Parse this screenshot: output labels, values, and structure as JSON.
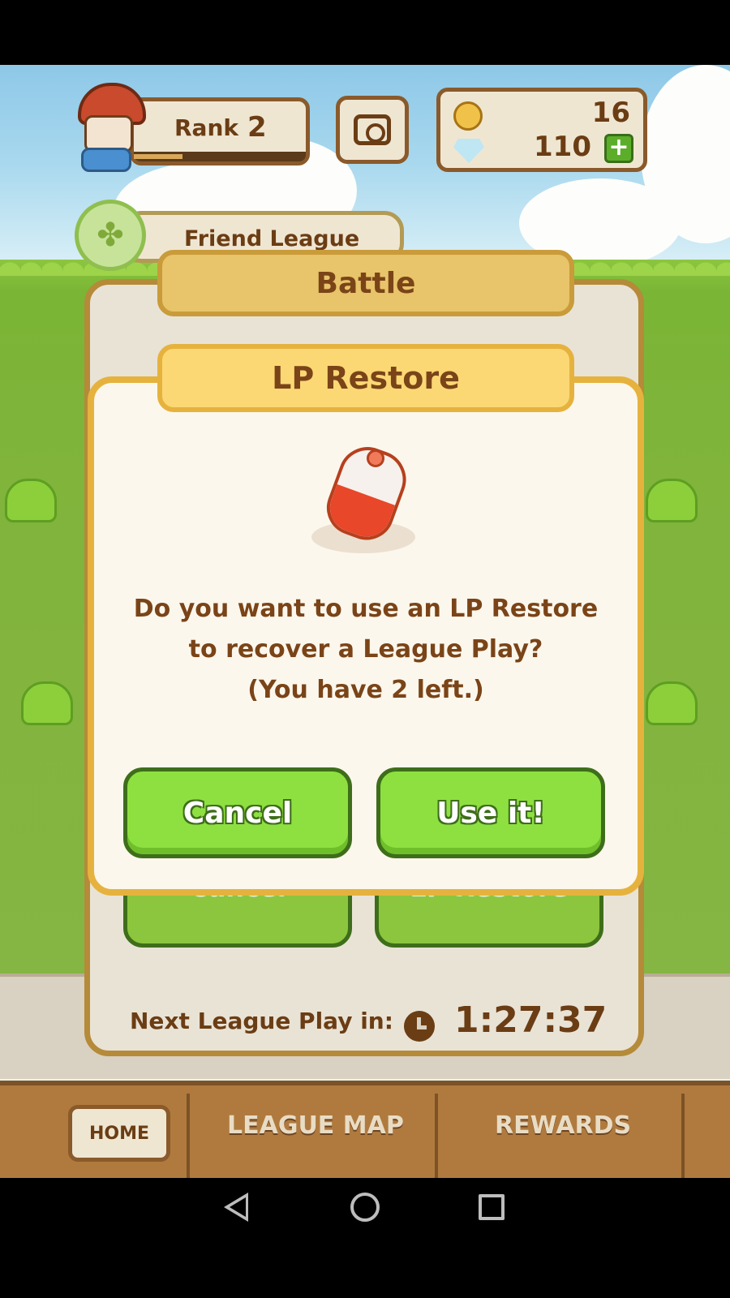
{
  "header": {
    "rank_label": "Rank",
    "rank_value": "2",
    "coins": "16",
    "gems": "110",
    "plus": "+"
  },
  "league": {
    "name": "Friend League"
  },
  "battle_panel": {
    "title": "Battle",
    "cancel_label": "Cancel",
    "restore_label": "LP Restore"
  },
  "dialog": {
    "title": "LP Restore",
    "message_line1": "Do you want to use an LP Restore",
    "message_line2": "to recover a League Play?",
    "message_line3": "(You have 2 left.)",
    "cancel_label": "Cancel",
    "confirm_label": "Use it!"
  },
  "footer": {
    "next_play_label": "Next League Play in:",
    "timer": "1:27:37"
  },
  "bottom_nav": {
    "home": "HOME",
    "league_map": "LEAGUE MAP",
    "rewards": "REWARDS"
  },
  "icons": {
    "camera": "camera-icon",
    "coin": "coin-icon",
    "gem": "gem-icon",
    "clover": "clover-icon",
    "potion": "potion-icon",
    "clock": "clock-icon"
  },
  "colors": {
    "dialog_border": "#e6b23e",
    "button_green": "#8ee040",
    "text_brown": "#7a4418"
  }
}
